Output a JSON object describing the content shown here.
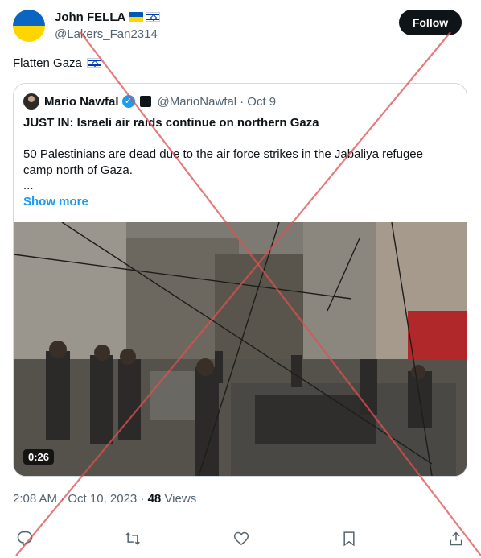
{
  "author": {
    "name": "John FELLA",
    "handle": "@Lakers_Fan2314"
  },
  "follow_label": "Follow",
  "tweet_text": "Flatten Gaza",
  "quote": {
    "name": "Mario Nawfal",
    "handle": "@MarioNawfal",
    "date": "· Oct 9",
    "headline": "JUST IN: Israeli air raids continue on northern Gaza",
    "body": "50 Palestinians are dead due to the air force strikes in the Jabaliya refugee camp north of Gaza.",
    "ellipsis": "...",
    "show_more": "Show more",
    "video_time": "0:26"
  },
  "meta": {
    "timestamp": "2:08 AM · Oct 10, 2023 ·",
    "views_count": "48",
    "views_label": "Views"
  },
  "icons": [
    "reply-icon",
    "retweet-icon",
    "like-icon",
    "bookmark-icon",
    "share-icon"
  ],
  "colors": {
    "accent": "#1d9bf0",
    "cross": "#e0504f",
    "text": "#0f1419",
    "muted": "#536471"
  }
}
